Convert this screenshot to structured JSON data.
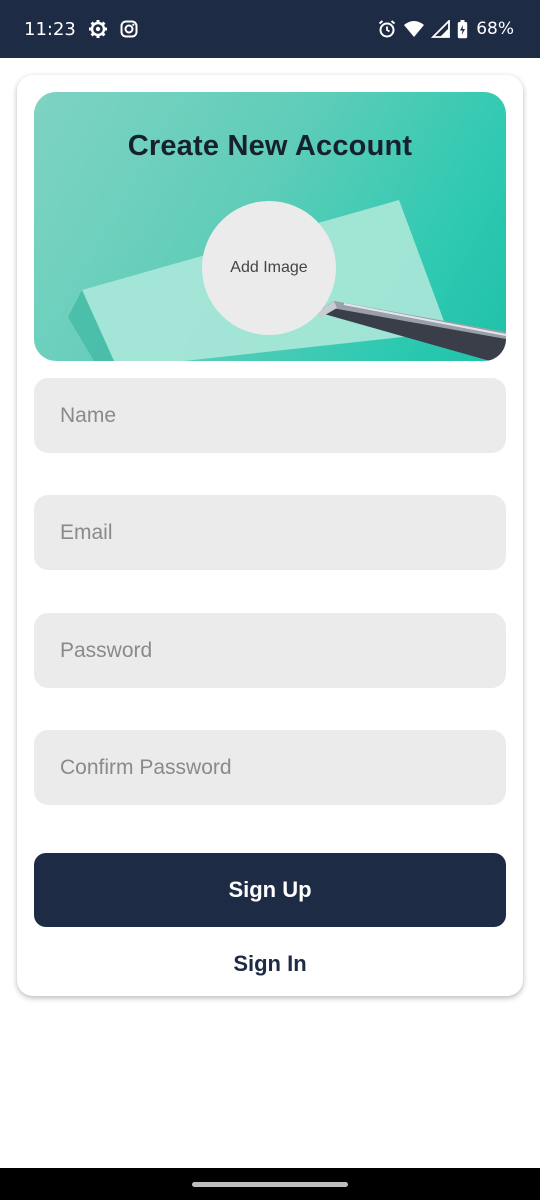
{
  "status_bar": {
    "time": "11:23",
    "battery": "68%",
    "icons": [
      "settings-gear-icon",
      "instagram-icon",
      "alarm-icon",
      "wifi-icon",
      "cell-signal-icon",
      "battery-charging-icon"
    ]
  },
  "hero": {
    "title": "Create New Account",
    "add_image_label": "Add Image"
  },
  "form": {
    "name_placeholder": "Name",
    "email_placeholder": "Email",
    "password_placeholder": "Password",
    "confirm_password_placeholder": "Confirm Password"
  },
  "actions": {
    "sign_up_label": "Sign Up",
    "sign_in_label": "Sign In"
  },
  "colors": {
    "status_bar": "#1e2b45",
    "primary": "#1e2b45",
    "field_bg": "#ebebeb",
    "hero_accent": "#2ec9b1"
  }
}
